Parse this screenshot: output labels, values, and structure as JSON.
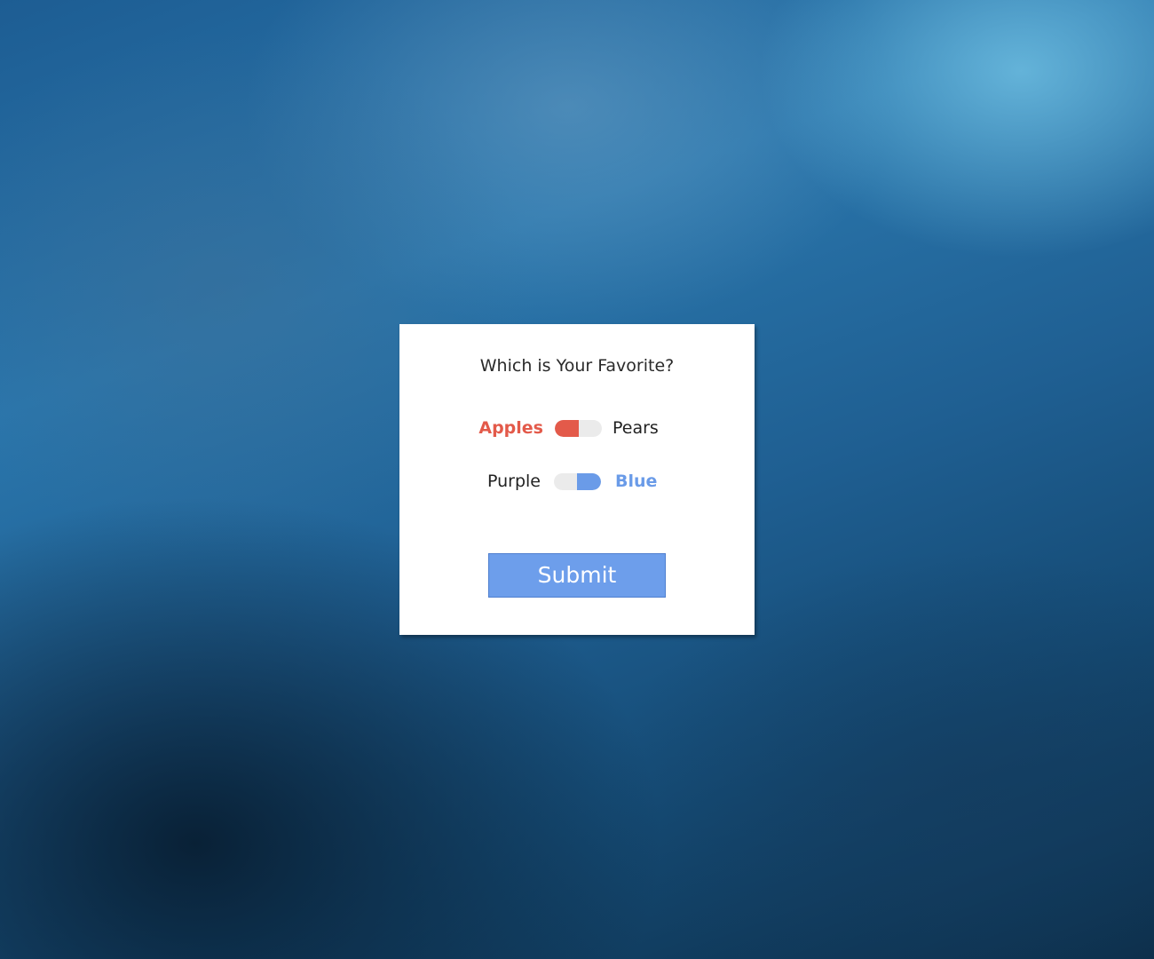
{
  "dialog": {
    "title": "Which is Your Favorite?",
    "toggles": [
      {
        "left_label": "Apples",
        "right_label": "Pears",
        "selected": "left",
        "accent_color": "#e35a4a"
      },
      {
        "left_label": "Purple",
        "right_label": "Blue",
        "selected": "right",
        "accent_color": "#6a9be8"
      }
    ],
    "submit_label": "Submit"
  },
  "colors": {
    "card_background": "#ffffff",
    "submit_background": "#6d9eeb",
    "toggle_track": "#ebebeb"
  }
}
